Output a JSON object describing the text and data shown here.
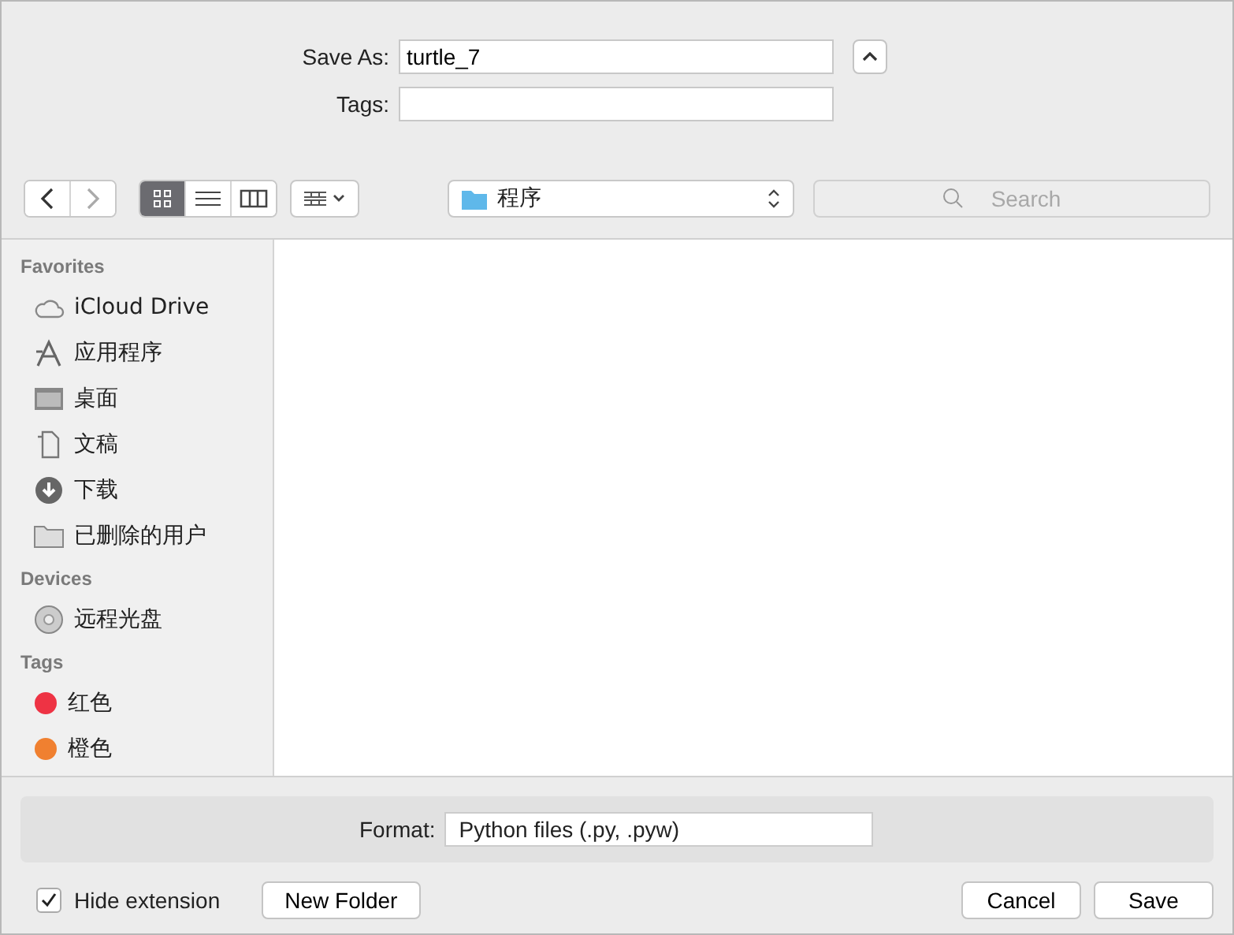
{
  "save_as": {
    "label": "Save As:",
    "value": "turtle_7"
  },
  "tags_field": {
    "label": "Tags:"
  },
  "expand_button": {
    "expanded": true
  },
  "view_modes": [
    {
      "kind": "icons",
      "selected": true
    },
    {
      "kind": "list",
      "selected": false
    },
    {
      "kind": "columns",
      "selected": false
    }
  ],
  "location": {
    "label": "程序"
  },
  "search": {
    "placeholder": "Search"
  },
  "sidebar": [
    {
      "heading": "Favorites",
      "items": [
        {
          "kind": "cloud",
          "label": "iCloud Drive"
        },
        {
          "kind": "apps",
          "label": "应用程序"
        },
        {
          "kind": "desktop",
          "label": "桌面"
        },
        {
          "kind": "documents",
          "label": "文稿"
        },
        {
          "kind": "download",
          "label": "下载"
        },
        {
          "kind": "folder",
          "label": "已删除的用户"
        }
      ]
    },
    {
      "heading": "Devices",
      "items": [
        {
          "kind": "disc",
          "label": "远程光盘"
        }
      ]
    },
    {
      "heading": "Tags",
      "items": [
        {
          "kind": "tag",
          "label": "红色",
          "color": "#ee3344"
        },
        {
          "kind": "tag",
          "label": "橙色",
          "color": "#f08030"
        }
      ]
    }
  ],
  "format": {
    "label": "Format:",
    "value": "Python files (.py, .pyw)"
  },
  "hide_extension": {
    "label": "Hide extension",
    "checked": true
  },
  "new_folder": "New Folder",
  "buttons": [
    "Cancel",
    "Save"
  ]
}
